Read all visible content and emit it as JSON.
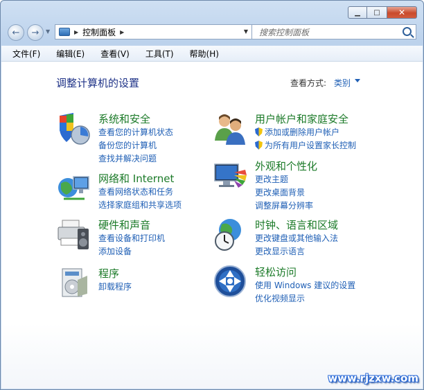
{
  "window": {
    "minimize_icon": "minimize-icon",
    "maximize_icon": "maximize-icon",
    "close_icon": "close-icon"
  },
  "nav": {
    "address_path": "控制面板",
    "search_placeholder": "搜索控制面板"
  },
  "menu": [
    "文件(F)",
    "编辑(E)",
    "查看(V)",
    "工具(T)",
    "帮助(H)"
  ],
  "content": {
    "heading": "调整计算机的设置",
    "view_by_label": "查看方式:",
    "view_by_value": "类别"
  },
  "categories": [
    {
      "title": "系统和安全",
      "icon": "system-security-icon",
      "links": [
        "查看您的计算机状态",
        "备份您的计算机",
        "查找并解决问题"
      ]
    },
    {
      "title": "网络和 Internet",
      "icon": "network-icon",
      "links": [
        "查看网络状态和任务",
        "选择家庭组和共享选项"
      ]
    },
    {
      "title": "硬件和声音",
      "icon": "hardware-sound-icon",
      "links": [
        "查看设备和打印机",
        "添加设备"
      ]
    },
    {
      "title": "程序",
      "icon": "programs-icon",
      "links": [
        "卸载程序"
      ]
    },
    {
      "title": "用户帐户和家庭安全",
      "icon": "user-accounts-icon",
      "links": [
        "添加或删除用户帐户",
        "为所有用户设置家长控制"
      ]
    },
    {
      "title": "外观和个性化",
      "icon": "appearance-icon",
      "links": [
        "更改主题",
        "更改桌面背景",
        "调整屏幕分辨率"
      ]
    },
    {
      "title": "时钟、语言和区域",
      "icon": "clock-region-icon",
      "links": [
        "更改键盘或其他输入法",
        "更改显示语言"
      ]
    },
    {
      "title": "轻松访问",
      "icon": "ease-of-access-icon",
      "links": [
        "使用 Windows 建议的设置",
        "优化视频显示"
      ]
    }
  ],
  "watermark": "www.rjzxw.com"
}
